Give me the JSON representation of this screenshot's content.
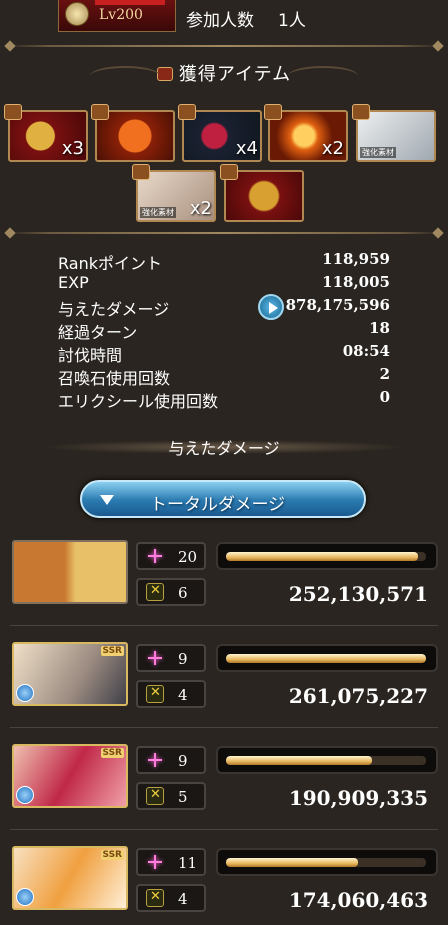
{
  "header": {
    "boss_level": "Lv200",
    "participants_label": "参加人数",
    "participants_count": "1人"
  },
  "items_section": {
    "title": "獲得アイテム",
    "items": [
      {
        "name": "gold-medal-item",
        "qty": "x3"
      },
      {
        "name": "red-book-item",
        "qty": ""
      },
      {
        "name": "red-crystal-item",
        "qty": "x4"
      },
      {
        "name": "flame-orb-item",
        "qty": "x2"
      },
      {
        "name": "silver-weapon-item",
        "qty": "",
        "tag": "強化素材"
      },
      {
        "name": "character-card-item",
        "qty": "x2",
        "tag": "強化素材"
      },
      {
        "name": "gold-coin-item",
        "qty": ""
      }
    ]
  },
  "stats": [
    {
      "label": "Rankポイント",
      "value": "118,959"
    },
    {
      "label": "EXP",
      "value": "118,005"
    },
    {
      "label": "与えたダメージ",
      "value": "878,175,596"
    },
    {
      "label": "経過ターン",
      "value": "18"
    },
    {
      "label": "討伐時間",
      "value": "08:54"
    },
    {
      "label": "召喚石使用回数",
      "value": "2"
    },
    {
      "label": "エリクシール使用回数",
      "value": "0"
    }
  ],
  "damage_section": {
    "title": "与えたダメージ",
    "total_button": "トータルダメージ"
  },
  "members": [
    {
      "name": "main-character",
      "star": "20",
      "cross": "6",
      "damage": "252,130,571",
      "bar_fill": 0.96,
      "ssr": false
    },
    {
      "name": "member-2",
      "star": "9",
      "cross": "4",
      "damage": "261,075,227",
      "bar_fill": 1.0,
      "ssr": true,
      "ssr_label": "SSR"
    },
    {
      "name": "member-3",
      "star": "9",
      "cross": "5",
      "damage": "190,909,335",
      "bar_fill": 0.73,
      "ssr": true,
      "ssr_label": "SSR"
    },
    {
      "name": "member-4",
      "star": "11",
      "cross": "4",
      "damage": "174,060,463",
      "bar_fill": 0.66,
      "ssr": true,
      "ssr_label": "SSR"
    }
  ]
}
